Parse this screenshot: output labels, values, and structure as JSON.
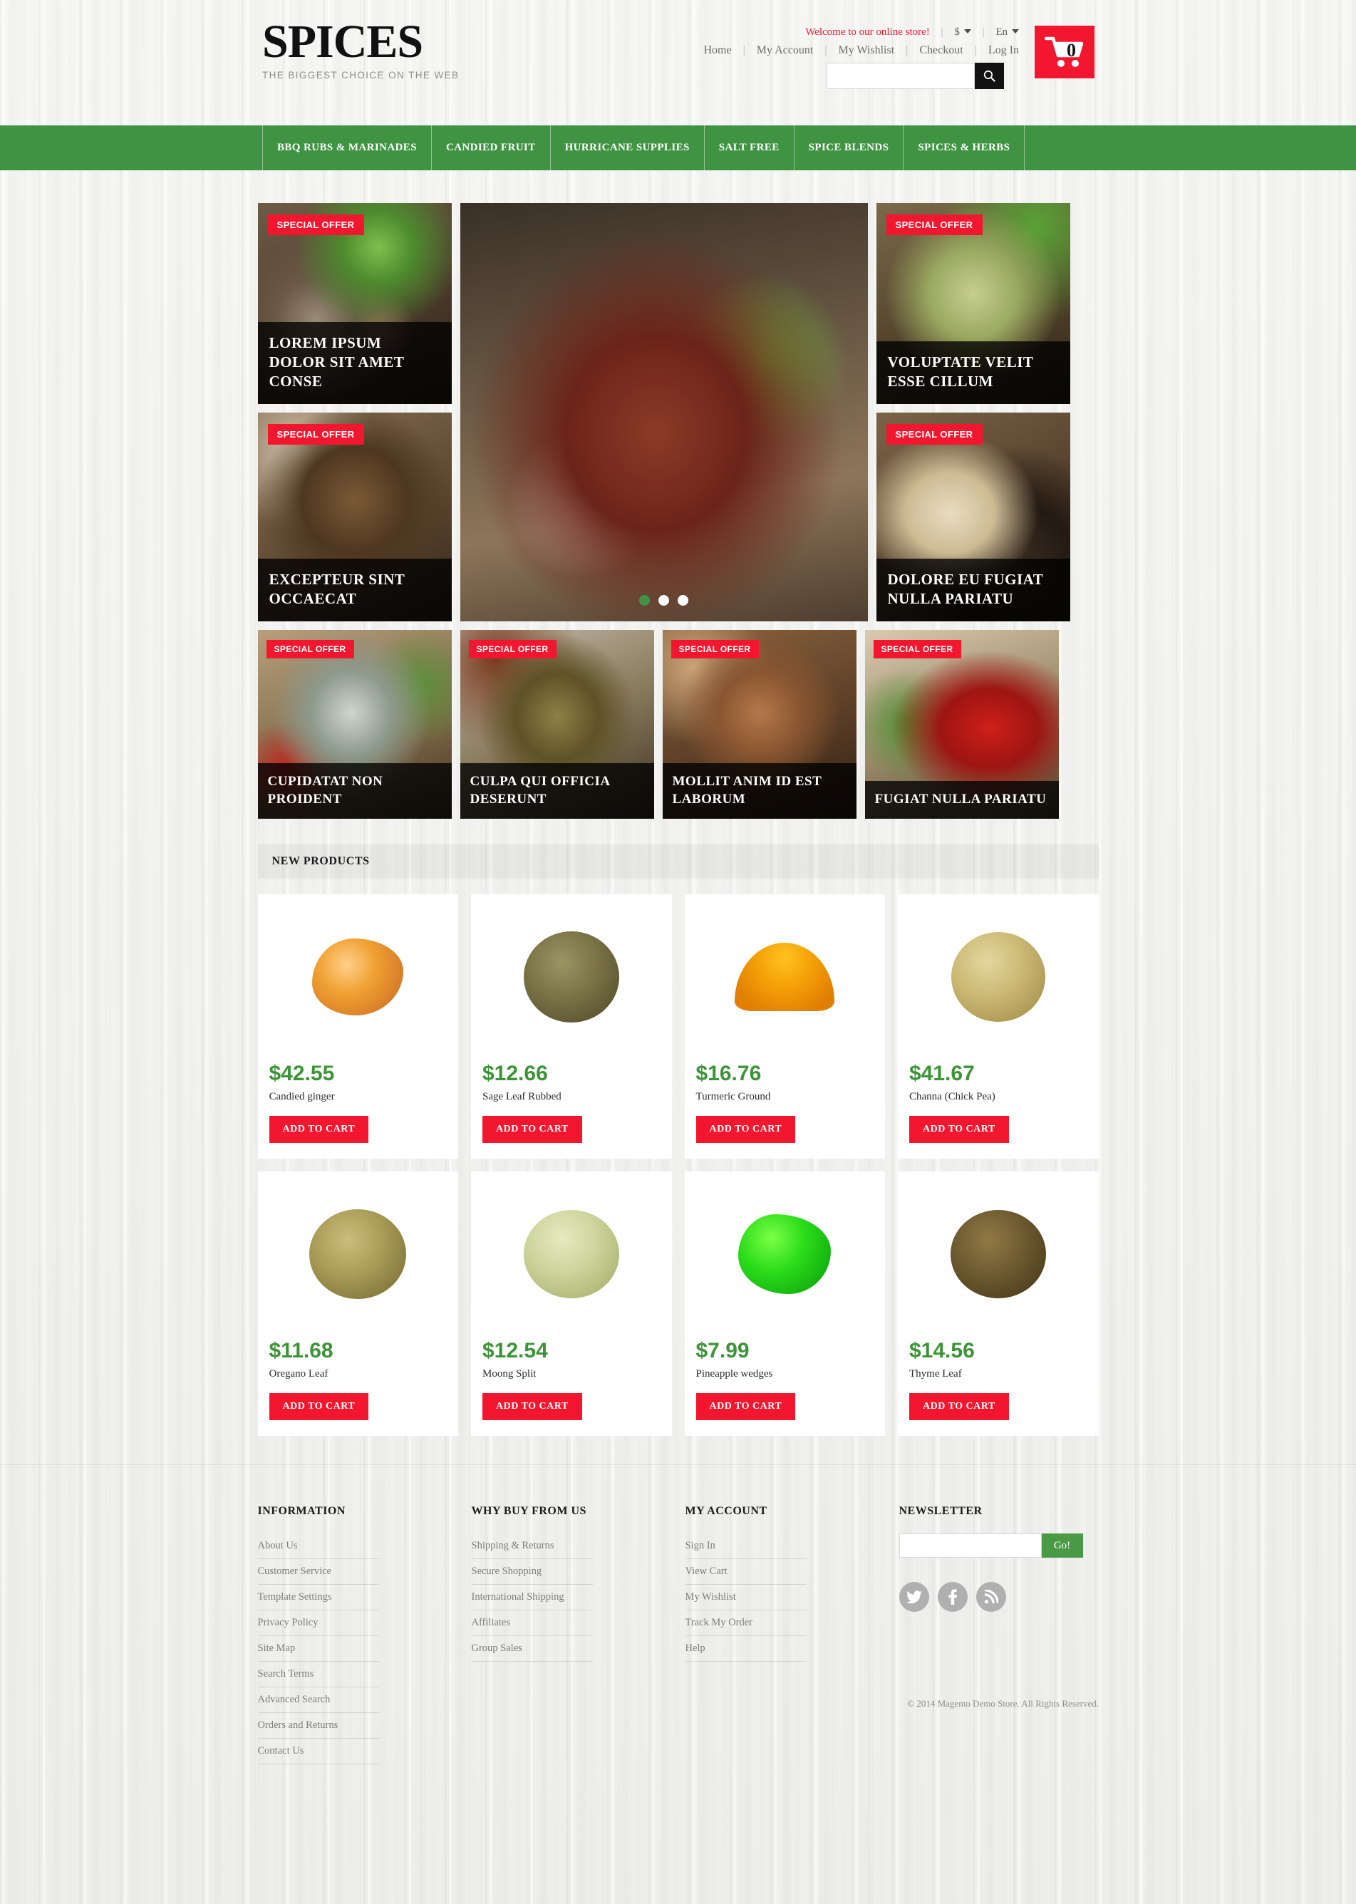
{
  "header": {
    "logo_title": "SPICES",
    "logo_tagline": "THE BIGGEST CHOICE ON THE WEB",
    "welcome": "Welcome to our online store!",
    "currency": "$",
    "language": "En",
    "top_links": [
      "Home",
      "My Account",
      "My Wishlist",
      "Checkout",
      "Log In"
    ],
    "search_placeholder": "",
    "search_value": "",
    "search_icon": "search-icon",
    "cart_icon": "shopping-cart-icon",
    "cart_count": "0"
  },
  "nav": {
    "items": [
      "BBQ RUBS & MARINADES",
      "CANDIED FRUIT",
      "HURRICANE SUPPLIES",
      "SALT FREE",
      "SPICE BLENDS",
      "SPICES & HERBS"
    ]
  },
  "promo": {
    "badge_label": "SPECIAL OFFER",
    "tiles": [
      {
        "caption": "LOREM IPSUM DOLOR SIT AMET CONSE",
        "art": "ph-pepperbowl"
      },
      {
        "caption": "EXCEPTEUR SINT OCCAECAT",
        "art": "ph-cloves"
      },
      {
        "caption": "VOLUPTATE VELIT ESSE CILLUM",
        "art": "ph-cardamom"
      },
      {
        "caption": "DOLORE EU FUGIAT NULLA PARIATU",
        "art": "ph-spoon"
      },
      {
        "caption": "CUPIDATAT NON PROIDENT",
        "art": "ph-mortar"
      },
      {
        "caption": "CULPA QUI OFFICIA DESERUNT",
        "art": "ph-cumin"
      },
      {
        "caption": "MOLLIT ANIM ID EST LABORUM",
        "art": "ph-anise"
      },
      {
        "caption": "FUGIAT NULLA PARIATU",
        "art": "ph-chili"
      }
    ],
    "slider": {
      "art": "ph-steak",
      "slides": 3,
      "active_index": 0
    }
  },
  "new_products": {
    "section_title": "NEW PRODUCTS",
    "add_to_cart_label": "ADD TO CART",
    "items": [
      {
        "price": "$42.55",
        "name": "Candied ginger",
        "art": "pb-ginger"
      },
      {
        "price": "$12.66",
        "name": "Sage Leaf Rubbed",
        "art": "pb-sage"
      },
      {
        "price": "$16.76",
        "name": "Turmeric Ground",
        "art": "pb-turmeric"
      },
      {
        "price": "$41.67",
        "name": "Channa (Chick Pea)",
        "art": "pb-channa"
      },
      {
        "price": "$11.68",
        "name": "Oregano Leaf",
        "art": "pb-oregano"
      },
      {
        "price": "$12.54",
        "name": "Moong Split",
        "art": "pb-moong"
      },
      {
        "price": "$7.99",
        "name": "Pineapple wedges",
        "art": "pb-pineapple"
      },
      {
        "price": "$14.56",
        "name": "Thyme Leaf",
        "art": "pb-thyme"
      }
    ]
  },
  "footer": {
    "columns": [
      {
        "heading": "INFORMATION",
        "links": [
          "About Us",
          "Customer Service",
          "Template Settings",
          "Privacy Policy",
          "Site Map",
          "Search Terms",
          "Advanced Search",
          "Orders and Returns",
          "Contact Us"
        ]
      },
      {
        "heading": "WHY BUY FROM US",
        "links": [
          "Shipping & Returns",
          "Secure Shopping",
          "International Shipping",
          "Affiliates",
          "Group Sales"
        ]
      },
      {
        "heading": "MY ACCOUNT",
        "links": [
          "Sign In",
          "View Cart",
          "My Wishlist",
          "Track My Order",
          "Help"
        ]
      }
    ],
    "newsletter": {
      "heading": "NEWSLETTER",
      "input_value": "",
      "input_placeholder": "",
      "go_label": "Go!",
      "socials": [
        "twitter-icon",
        "facebook-icon",
        "rss-icon"
      ]
    },
    "copyright": "© 2014 Magento Demo Store. All Rights Reserved."
  },
  "colors": {
    "green": "#3f9342",
    "red": "#f2162f",
    "price_green": "#3d9437",
    "dark_caption": "rgba(0,0,0,0.78)"
  }
}
